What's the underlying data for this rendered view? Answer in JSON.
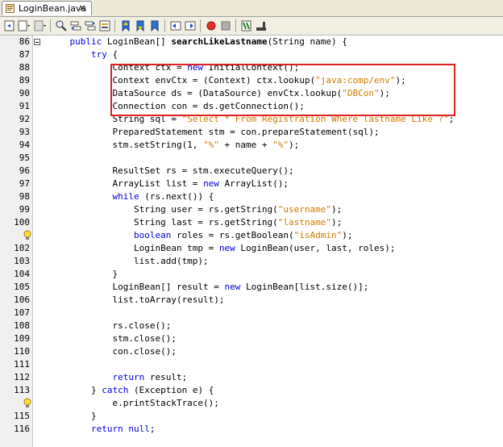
{
  "tab": {
    "label": "LoginBean.java",
    "close": "×"
  },
  "toolbar": {
    "buttons": [
      "back-icon",
      "history-icon",
      "forward-icon",
      "find-icon",
      "find-previous-icon",
      "find-next-icon",
      "toggle-highlight-icon",
      "previous-bookmark-icon",
      "next-bookmark-icon",
      "toggle-bookmark-icon",
      "shift-left-icon",
      "shift-right-icon",
      "start-macro-icon",
      "stop-macro-icon",
      "comment-icon",
      "uncomment-icon"
    ]
  },
  "lines": [
    {
      "num": "86",
      "tokens": [
        [
          "",
          "    "
        ],
        [
          "kw",
          "public"
        ],
        [
          "",
          " LoginBean[] "
        ],
        [
          "bold",
          "searchLikeLastname"
        ],
        [
          "",
          "(String name) {"
        ]
      ]
    },
    {
      "num": "87",
      "tokens": [
        [
          "",
          "        "
        ],
        [
          "kw",
          "try"
        ],
        [
          "",
          " {"
        ]
      ]
    },
    {
      "num": "88",
      "tokens": [
        [
          "",
          "            Context ctx = "
        ],
        [
          "kw",
          "new"
        ],
        [
          "",
          " InitialContext();"
        ]
      ]
    },
    {
      "num": "89",
      "tokens": [
        [
          "",
          "            Context envCtx = (Context) ctx.lookup("
        ],
        [
          "str",
          "\"java:comp/env\""
        ],
        [
          "",
          ");"
        ]
      ]
    },
    {
      "num": "90",
      "tokens": [
        [
          "",
          "            DataSource ds = (DataSource) envCtx.lookup("
        ],
        [
          "str",
          "\"DBCon\""
        ],
        [
          "",
          ");"
        ]
      ]
    },
    {
      "num": "91",
      "tokens": [
        [
          "",
          "            Connection con = ds.getConnection();"
        ]
      ]
    },
    {
      "num": "92",
      "tokens": [
        [
          "",
          "            String sql = "
        ],
        [
          "str",
          "\"Select * From Registration Where lastname Like ?\""
        ],
        [
          "",
          ";"
        ]
      ]
    },
    {
      "num": "93",
      "tokens": [
        [
          "",
          "            PreparedStatement stm = con.prepareStatement(sql);"
        ]
      ]
    },
    {
      "num": "94",
      "tokens": [
        [
          "",
          "            stm.setString(1, "
        ],
        [
          "str",
          "\"%\""
        ],
        [
          "",
          " + name + "
        ],
        [
          "str",
          "\"%\""
        ],
        [
          "",
          ");"
        ]
      ]
    },
    {
      "num": "95",
      "tokens": []
    },
    {
      "num": "96",
      "tokens": [
        [
          "",
          "            ResultSet rs = stm.executeQuery();"
        ]
      ]
    },
    {
      "num": "97",
      "tokens": [
        [
          "",
          "            ArrayList list = "
        ],
        [
          "kw",
          "new"
        ],
        [
          "",
          " ArrayList();"
        ]
      ]
    },
    {
      "num": "98",
      "tokens": [
        [
          "",
          "            "
        ],
        [
          "kw",
          "while"
        ],
        [
          "",
          " (rs.next()) {"
        ]
      ]
    },
    {
      "num": "99",
      "tokens": [
        [
          "",
          "                String user = rs.getString("
        ],
        [
          "str",
          "\"username\""
        ],
        [
          "",
          ");"
        ]
      ]
    },
    {
      "num": "100",
      "tokens": [
        [
          "",
          "                String last = rs.getString("
        ],
        [
          "str",
          "\"lastname\""
        ],
        [
          "",
          ");"
        ]
      ]
    },
    {
      "num": "",
      "warn": true,
      "tokens": [
        [
          "",
          "                "
        ],
        [
          "kw",
          "boolean"
        ],
        [
          "",
          " roles = rs.getBoolean("
        ],
        [
          "str",
          "\"isAdmin\""
        ],
        [
          "",
          ");"
        ]
      ]
    },
    {
      "num": "102",
      "tokens": [
        [
          "",
          "                LoginBean tmp = "
        ],
        [
          "kw",
          "new"
        ],
        [
          "",
          " LoginBean(user, last, roles);"
        ]
      ]
    },
    {
      "num": "103",
      "tokens": [
        [
          "",
          "                list.add(tmp);"
        ]
      ]
    },
    {
      "num": "104",
      "tokens": [
        [
          "",
          "            }"
        ]
      ]
    },
    {
      "num": "105",
      "tokens": [
        [
          "",
          "            LoginBean[] result = "
        ],
        [
          "kw",
          "new"
        ],
        [
          "",
          " LoginBean[list.size()];"
        ]
      ]
    },
    {
      "num": "106",
      "tokens": [
        [
          "",
          "            list.toArray(result);"
        ]
      ]
    },
    {
      "num": "107",
      "tokens": []
    },
    {
      "num": "108",
      "tokens": [
        [
          "",
          "            rs.close();"
        ]
      ]
    },
    {
      "num": "109",
      "tokens": [
        [
          "",
          "            stm.close();"
        ]
      ]
    },
    {
      "num": "110",
      "tokens": [
        [
          "",
          "            con.close();"
        ]
      ]
    },
    {
      "num": "111",
      "tokens": []
    },
    {
      "num": "112",
      "tokens": [
        [
          "",
          "            "
        ],
        [
          "kw",
          "return"
        ],
        [
          "",
          " result;"
        ]
      ]
    },
    {
      "num": "113",
      "tokens": [
        [
          "",
          "        } "
        ],
        [
          "kw",
          "catch"
        ],
        [
          "",
          " (Exception e) {"
        ]
      ]
    },
    {
      "num": "",
      "warn": true,
      "tokens": [
        [
          "",
          "            e.printStackTrace();"
        ]
      ]
    },
    {
      "num": "115",
      "tokens": [
        [
          "",
          "        }"
        ]
      ]
    },
    {
      "num": "116",
      "tokens": [
        [
          "",
          "        "
        ],
        [
          "kw",
          "return"
        ],
        [
          "",
          " "
        ],
        [
          "kw",
          "null"
        ],
        [
          "",
          ";"
        ]
      ]
    }
  ]
}
